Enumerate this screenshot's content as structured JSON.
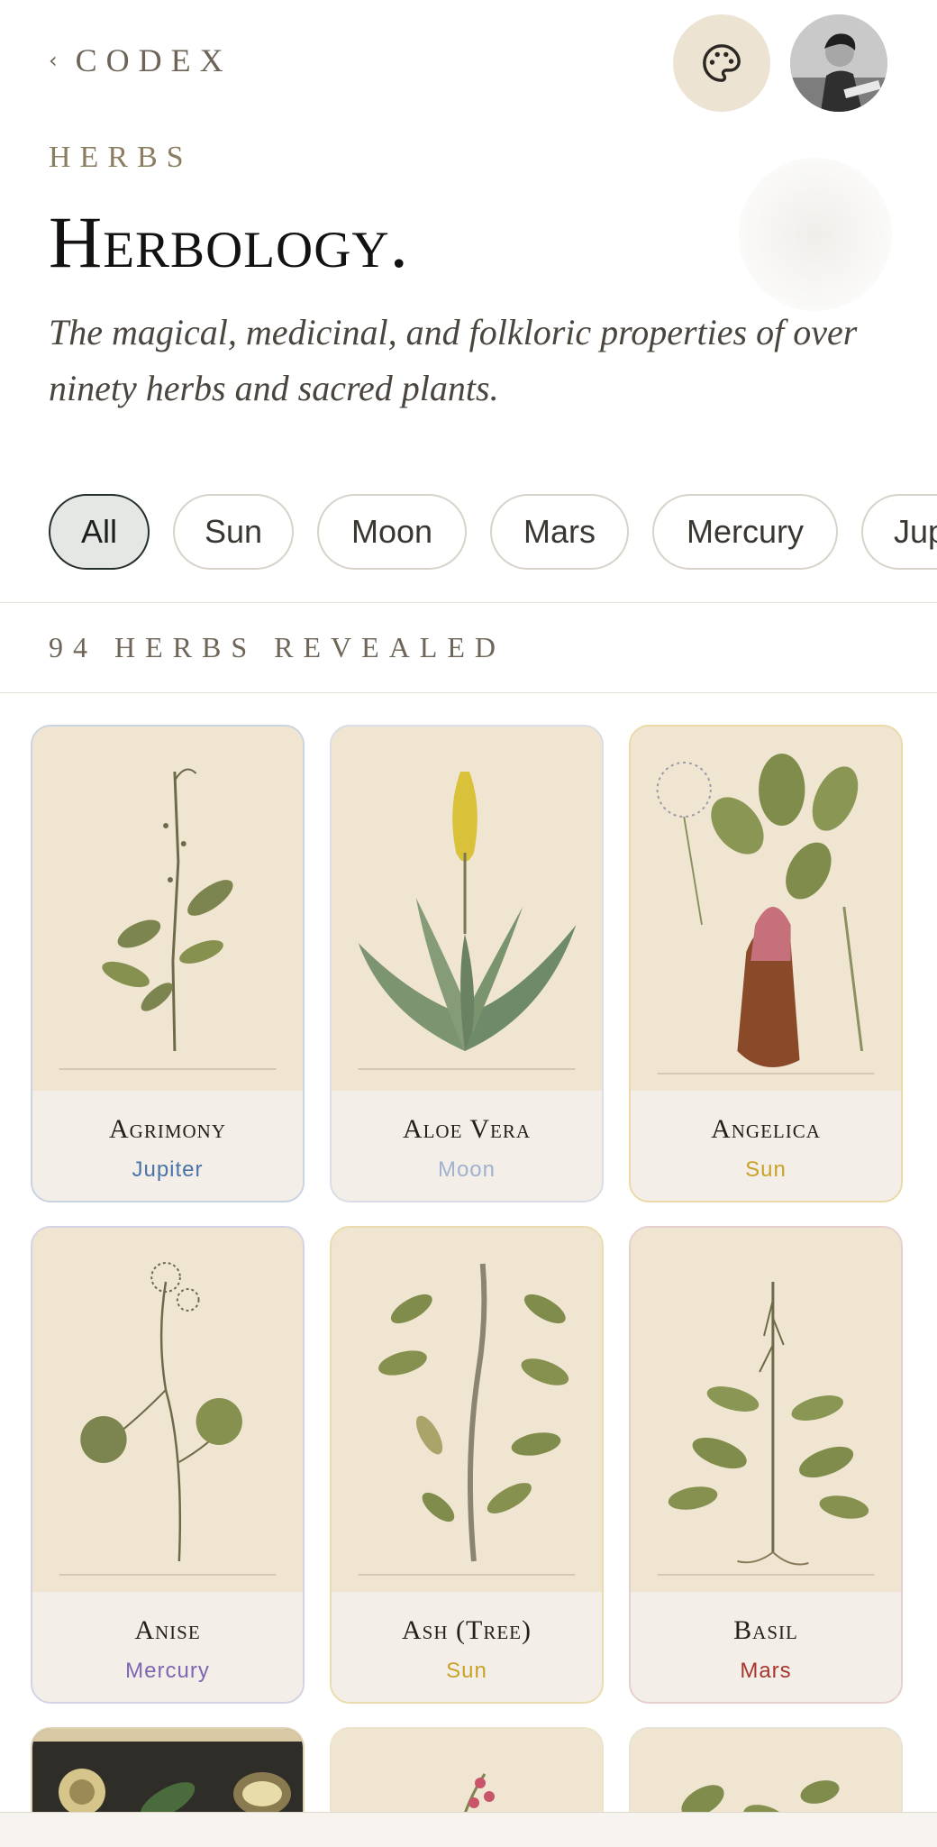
{
  "header": {
    "back_label": "CODEX"
  },
  "eyebrow": "HERBS",
  "page_title": "Herbology.",
  "subtitle": "The magical, medicinal, and folkloric properties of over ninety herbs and sacred plants.",
  "filters": [
    "All",
    "Sun",
    "Moon",
    "Mars",
    "Mercury",
    "Jupi"
  ],
  "active_filter": "All",
  "count_label": "94 HERBS REVEALED",
  "colors": {
    "Jupiter": "#4a73a8",
    "Moon": "#9fb2cf",
    "Sun": "#c9a227",
    "Mercury": "#7b67b3",
    "Mars": "#a8352e"
  },
  "herbs": [
    {
      "name": "Agrimony",
      "planet": "Jupiter"
    },
    {
      "name": "Aloe Vera",
      "planet": "Moon"
    },
    {
      "name": "Angelica",
      "planet": "Sun"
    },
    {
      "name": "Anise",
      "planet": "Mercury"
    },
    {
      "name": "Ash (Tree)",
      "planet": "Sun"
    },
    {
      "name": "Basil",
      "planet": "Mars"
    }
  ]
}
